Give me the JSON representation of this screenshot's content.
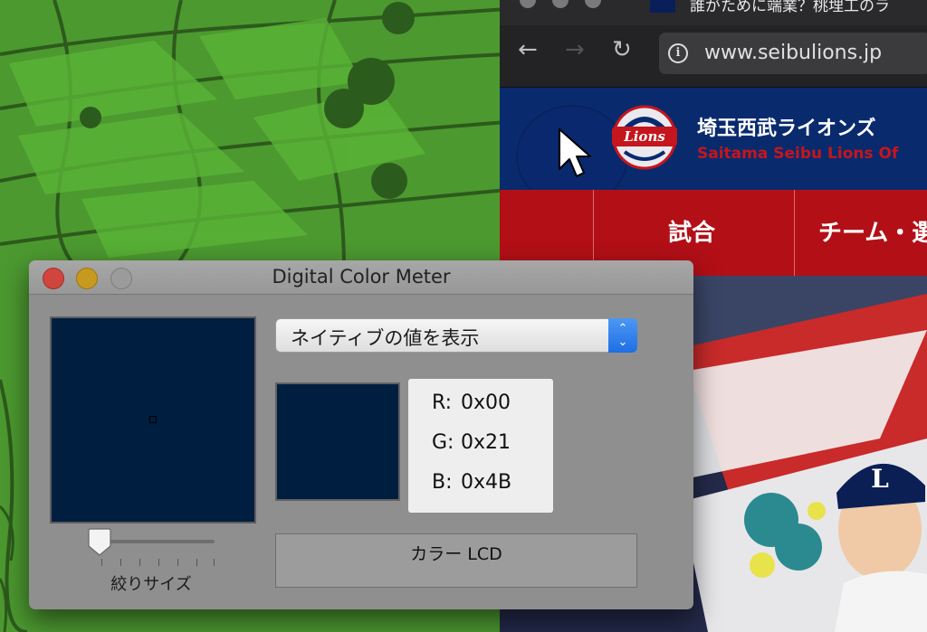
{
  "browser": {
    "tab_title": "誰がために端業？桃埋工のラ",
    "url": "www.seibulions.jp",
    "site": {
      "name_jp": "埼玉西武ライオンズ",
      "name_en": "Saitama Seibu Lions Of",
      "nav": [
        "試合",
        "チーム・選"
      ]
    }
  },
  "color_meter": {
    "title": "Digital Color Meter",
    "display_mode": "ネイティブの値を表示",
    "aperture_label": "絞りサイズ",
    "aperture_level": 0.0,
    "sampled_color": "#001e3f",
    "values": [
      {
        "label": "R:",
        "value": "0x00"
      },
      {
        "label": "G:",
        "value": "0x21"
      },
      {
        "label": "B:",
        "value": "0x4B"
      }
    ],
    "profile": "カラー LCD"
  },
  "colors": {
    "lions_blue": "#0a2a6e",
    "lions_red": "#b30f17",
    "meter_bg": "#8f8f8f",
    "popup_accent": "#2a7cf0"
  }
}
